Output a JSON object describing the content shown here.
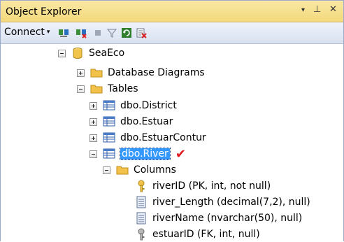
{
  "panel": {
    "title": "Object Explorer",
    "pin_glyph": "▾",
    "pushpin_glyph": "⊥",
    "close_glyph": "✕"
  },
  "toolbar": {
    "connect_label": "Connect",
    "connect_arrow": "▾",
    "buttons": [
      "connect-object-explorer-icon",
      "disconnect-icon",
      "stop-icon",
      "filter-icon",
      "refresh-icon",
      "new-query-icon"
    ]
  },
  "tree": {
    "database": "SeaEco",
    "database_diagrams": "Database Diagrams",
    "tables": "Tables",
    "table_items": [
      "dbo.District",
      "dbo.Estuar",
      "dbo.EstuarContur",
      "dbo.River"
    ],
    "columns": "Columns",
    "column_items": [
      "riverID (PK, int, not null)",
      "river_Length (decimal(7,2), null)",
      "riverName (nvarchar(50), null)",
      "estuarID (FK, int, null)"
    ]
  },
  "annotation": {
    "checkmark": "✔",
    "color": "#e0191f"
  },
  "colors": {
    "titlebar": "#f5dd87",
    "selection": "#3399ff",
    "folder": "#f3c24b"
  }
}
